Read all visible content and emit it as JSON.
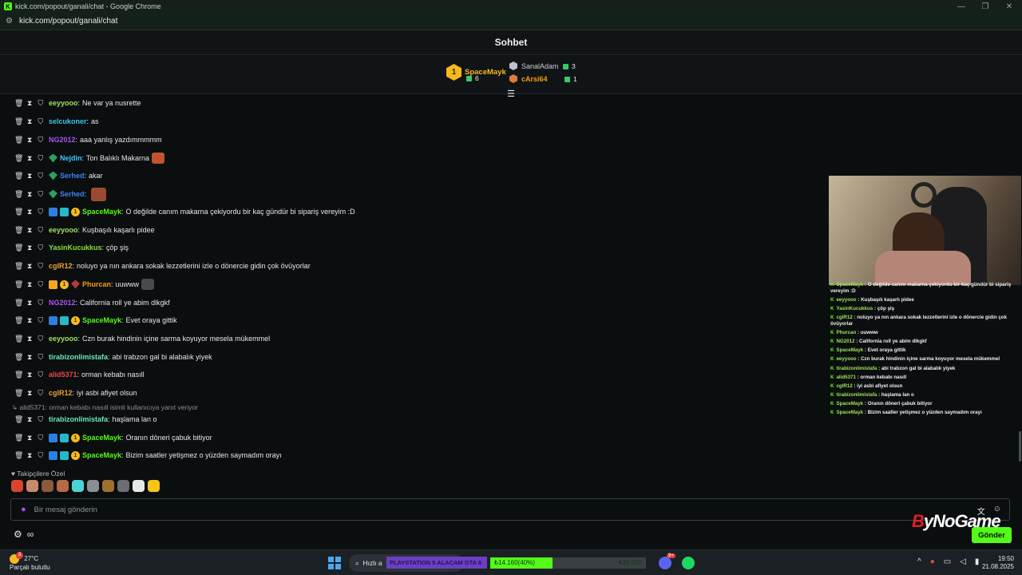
{
  "window": {
    "title": "kick.com/popout/ganali/chat - Google Chrome",
    "url": "kick.com/popout/ganali/chat"
  },
  "chat": {
    "header": "Sohbet",
    "leaderboard": {
      "first": {
        "name": "SpaceMayk",
        "rank": "1",
        "count": "6"
      },
      "second": {
        "name": "SanalAdam",
        "count": "3"
      },
      "third": {
        "name": "cArsi64",
        "count": "1"
      }
    },
    "messages": [
      {
        "user": "eeyyooo",
        "color": "#9fe35c",
        "text": "Ne var ya nusrette"
      },
      {
        "user": "selcukoner",
        "color": "#3fc2e8",
        "text": "as"
      },
      {
        "user": "NG2012",
        "color": "#a855f7",
        "text": "aaa yanlış yazdımmmmm"
      },
      {
        "user": "Nejdin",
        "color": "#40c6ff",
        "text": "Ton Balıklı Makarna"
      },
      {
        "user": "Serhed",
        "color": "#3b82f6",
        "text": "akar"
      },
      {
        "user": "Serhed",
        "color": "#3b82f6",
        "text": ""
      },
      {
        "user": "SpaceMayk",
        "color": "#53fc18",
        "text": "O değilde canım makarna çekiyordu bir kaç gündür bi sipariş vereyim :D"
      },
      {
        "user": "eeyyooo",
        "color": "#9fe35c",
        "text": "Kuşbaşılı kaşarlı pidee"
      },
      {
        "user": "YasinKucukkus",
        "color": "#84e03a",
        "text": "çöp şiş"
      },
      {
        "user": "cglR12",
        "color": "#e9a43b",
        "text": "noluyo ya nın ankara sokak lezzetlerini izle o dönercie gidin çok övüyorlar"
      },
      {
        "user": "Phurcan",
        "color": "#f59e0b",
        "text": "uuwww"
      },
      {
        "user": "NG2012",
        "color": "#a855f7",
        "text": "California roll ye abim dlkgkf"
      },
      {
        "user": "SpaceMayk",
        "color": "#53fc18",
        "text": "Evet oraya gittik"
      },
      {
        "user": "eeyyooo",
        "color": "#9fe35c",
        "text": "Czn burak hindinin içine sarma koyuyor mesela mükemmel"
      },
      {
        "user": "tirabizonlimistafa",
        "color": "#6ee7b7",
        "text": "abi trabzon gal bi alabalık yiyek"
      },
      {
        "user": "alid5371",
        "color": "#ef4444",
        "text": "orman kebabı nasıll"
      },
      {
        "user": "cglR12",
        "color": "#e9a43b",
        "text": "iyi asbi afiyet olsun"
      },
      {
        "user": "tirabizonlimistafa",
        "color": "#6ee7b7",
        "text": "haşlama lan o"
      },
      {
        "user": "SpaceMayk",
        "color": "#53fc18",
        "text": "Oranın döneri çabuk bitiyor"
      },
      {
        "user": "SpaceMayk",
        "color": "#53fc18",
        "text": "Bizim saatler yetişmez o yüzden saymadım orayı"
      }
    ],
    "reply_note": "alid5371: orman kebabı nasıll isimli kullanıcıya yanıt veriyor",
    "emote_section_title": "Takipçilere Özel",
    "input_placeholder": "Bir mesaj gönderin",
    "send_label": "Gönder"
  },
  "overlay": {
    "watermark_prefix": "B",
    "watermark_rest": "yNoGame",
    "chat_lines": [
      {
        "user": "SpaceMayk",
        "text": "O değilde canım makarna çekiyordu bir kaç gündür bi sipariş vereyim :D"
      },
      {
        "user": "eeyyooo",
        "text": "Kuşbaşılı kaşarlı pidee"
      },
      {
        "user": "YasinKucukkus",
        "text": "çöp şiş"
      },
      {
        "user": "cglR12",
        "text": "noluyo ya nın ankara sokak lezzetlerini izle o dönercie gidin çok övüyorlar"
      },
      {
        "user": "Phurcan",
        "text": "uuwww"
      },
      {
        "user": "NG2012",
        "text": "California roll ye abim dlkgkf"
      },
      {
        "user": "SpaceMayk",
        "text": "Evet oraya gittik"
      },
      {
        "user": "eeyyooo",
        "text": "Czn burak hindinin içine sarma koyuyor mesela mükemmel"
      },
      {
        "user": "tirabizonlimistafa",
        "text": "abi trabzon gal bi alabalık yiyek"
      },
      {
        "user": "alid5371",
        "text": "orman kebabı nasıll"
      },
      {
        "user": "cglR12",
        "text": "iyi asbi afiyet olsun"
      },
      {
        "user": "tirabizonlimistafa",
        "text": "haşlama lan o"
      },
      {
        "user": "SpaceMayk",
        "text": "Oranın döneri çabuk bitiyor"
      },
      {
        "user": "SpaceMayk",
        "text": "Bizim saatler yetişmez o yüzden saymadım orayı"
      }
    ]
  },
  "taskbar": {
    "temperature": "27°C",
    "weather": "Parçalı bulutlu",
    "weather_badge": "3",
    "search_label": "Hızlı a",
    "banner": "PLAYSTATION 5 ALACAM GTA 6",
    "donation_current": "₺14.160(40%)",
    "donation_goal": "₺35.000",
    "donation_fraction": 0.4,
    "discord_badge": "9+",
    "time": "19:50",
    "date": "21.08.2025"
  },
  "colors": {
    "accent": "#53fc18",
    "gold": "#f5b921",
    "background": "#0b0e0f"
  }
}
